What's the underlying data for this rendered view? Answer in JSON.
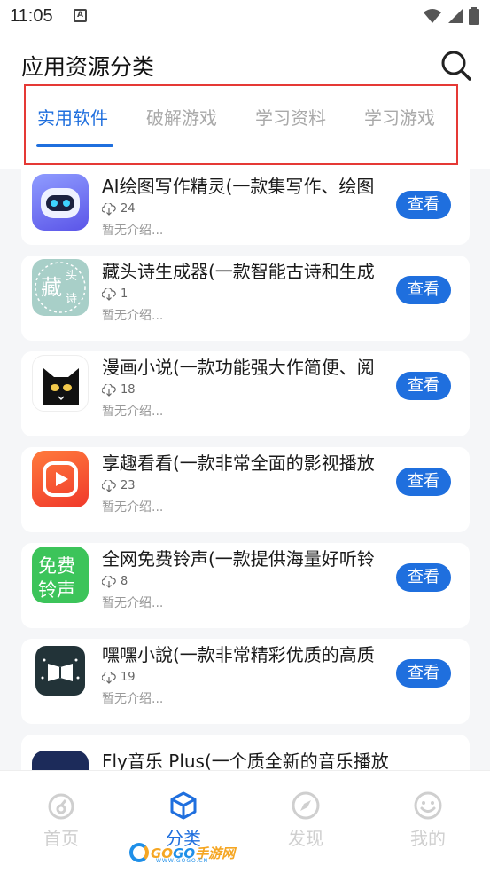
{
  "status": {
    "time": "11:05",
    "notif_letter": "A"
  },
  "header": {
    "title": "应用资源分类"
  },
  "tabs": [
    {
      "label": "实用软件",
      "active": true
    },
    {
      "label": "破解游戏",
      "active": false
    },
    {
      "label": "学习资料",
      "active": false
    },
    {
      "label": "学习游戏",
      "active": false
    }
  ],
  "apps": [
    {
      "name": "AI绘图写作精灵(一款集写作、绘图",
      "downloads": "24",
      "desc": "暂无介绍...",
      "action": "查看",
      "icon": "robot-app-icon"
    },
    {
      "name": "藏头诗生成器(一款智能古诗和生成",
      "downloads": "1",
      "desc": "暂无介绍...",
      "action": "查看",
      "icon": "poem-app-icon",
      "icon_text": [
        "藏",
        "头",
        "诗"
      ]
    },
    {
      "name": "漫画小说(一款功能强大作简便、阅",
      "downloads": "18",
      "desc": "暂无介绍...",
      "action": "查看",
      "icon": "cat-app-icon"
    },
    {
      "name": "享趣看看(一款非常全面的影视播放",
      "downloads": "23",
      "desc": "暂无介绍...",
      "action": "查看",
      "icon": "play-app-icon"
    },
    {
      "name": "全网免费铃声(一款提供海量好听铃",
      "downloads": "8",
      "desc": "暂无介绍...",
      "action": "查看",
      "icon": "ringtone-app-icon",
      "icon_text": [
        "免费",
        "铃声"
      ]
    },
    {
      "name": "嘿嘿小說(一款非常精彩优质的高质",
      "downloads": "19",
      "desc": "暂无介绍...",
      "action": "查看",
      "icon": "book-app-icon"
    },
    {
      "name": "Fly音乐 Plus(一个质全新的音乐播放",
      "downloads": "",
      "desc": "",
      "action": "",
      "icon": "music-app-icon"
    }
  ],
  "nav": [
    {
      "label": "首页",
      "icon": "home-icon",
      "active": false
    },
    {
      "label": "分类",
      "icon": "cube-icon",
      "active": true
    },
    {
      "label": "发现",
      "icon": "compass-icon",
      "active": false
    },
    {
      "label": "我的",
      "icon": "smile-icon",
      "active": false
    }
  ],
  "watermark": {
    "brand_a": "GO",
    "brand_b": "GO",
    "brand_c": "手游网",
    "url": "WWW.GOGO.CN"
  },
  "colors": {
    "accent": "#1f6fde",
    "highlight_box": "#e53935",
    "inactive_tab": "#a9a9a9"
  }
}
